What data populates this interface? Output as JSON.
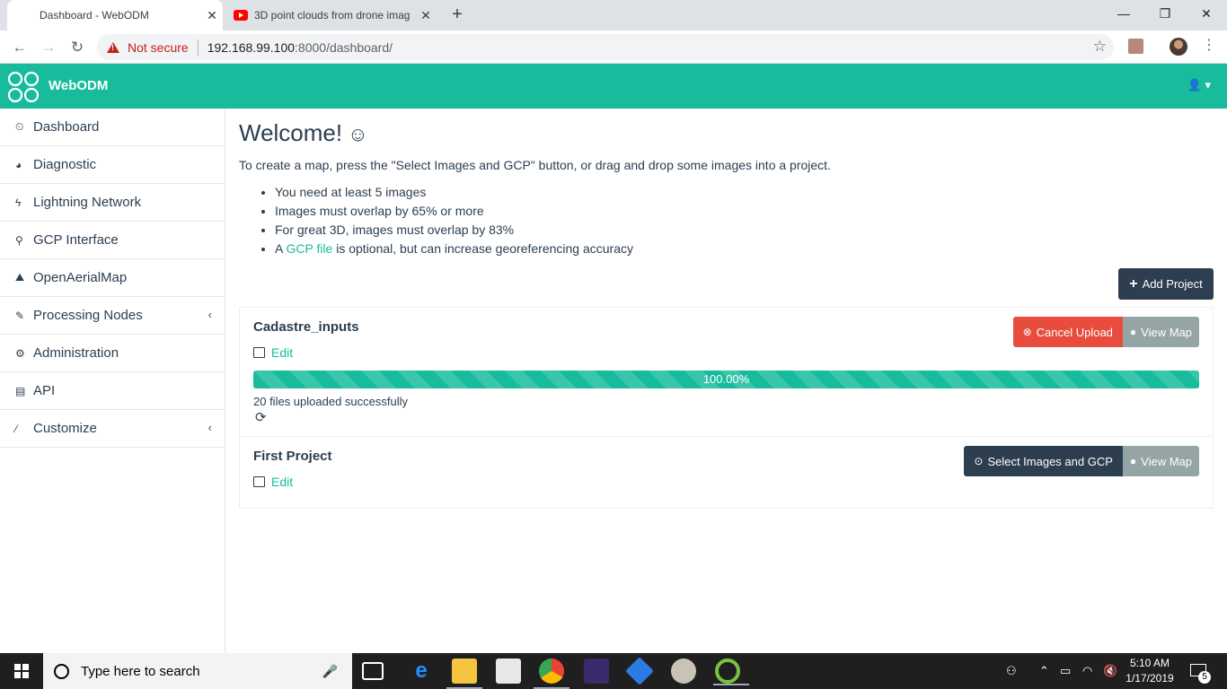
{
  "browser": {
    "tabs": [
      {
        "title": "Dashboard - WebODM",
        "active": true
      },
      {
        "title": "3D point clouds from drone imag",
        "active": false
      }
    ],
    "address": {
      "security_label": "Not secure",
      "url_host": "192.168.99.100",
      "url_rest": ":8000/dashboard/"
    },
    "window_controls": {
      "minimize": "—",
      "restore": "❐",
      "close": "✕"
    }
  },
  "app": {
    "brand": "WebODM",
    "accent_color": "#18bc9c",
    "dark_color": "#2c3e50"
  },
  "sidebar": {
    "items": [
      {
        "label": "Dashboard",
        "icon": "dashboard-icon",
        "glyph": "⏲"
      },
      {
        "label": "Diagnostic",
        "icon": "pie-chart-icon",
        "glyph": "◕"
      },
      {
        "label": "Lightning Network",
        "icon": "bolt-icon",
        "glyph": "ϟ"
      },
      {
        "label": "GCP Interface",
        "icon": "map-marker-icon",
        "glyph": "⚲"
      },
      {
        "label": "OpenAerialMap",
        "icon": "image-icon",
        "glyph": "⛰"
      },
      {
        "label": "Processing Nodes",
        "icon": "wrench-icon",
        "glyph": "🔧",
        "caret": "‹"
      },
      {
        "label": "Administration",
        "icon": "cogs-icon",
        "glyph": "⚙"
      },
      {
        "label": "API",
        "icon": "book-icon",
        "glyph": "▤"
      },
      {
        "label": "Customize",
        "icon": "magic-icon",
        "glyph": "⁄",
        "caret": "‹"
      }
    ]
  },
  "main": {
    "title": "Welcome!",
    "title_emoji": "☺",
    "intro": "To create a map, press the \"Select Images and GCP\" button, or drag and drop some images into a project.",
    "bullets": [
      "You need at least 5 images",
      "Images must overlap by 65% or more",
      "For great 3D, images must overlap by 83%"
    ],
    "bullet_gcp": {
      "prefix": "A ",
      "link": "GCP file",
      "suffix": " is optional, but can increase georeferencing accuracy"
    },
    "add_project_label": "Add Project",
    "add_project_icon": "+"
  },
  "projects": [
    {
      "name": "Cadastre_inputs",
      "edit_label": "Edit",
      "primary_button": "Cancel Upload",
      "secondary_button": "View Map",
      "progress_label": "100.00%",
      "progress_value": 100,
      "status": "20 files uploaded successfully"
    },
    {
      "name": "First Project",
      "edit_label": "Edit",
      "primary_button": "Select Images and GCP",
      "secondary_button": "View Map"
    }
  ],
  "taskbar": {
    "search_placeholder": "Type here to search",
    "time": "5:10 AM",
    "date": "1/17/2019",
    "notification_count": "5"
  }
}
